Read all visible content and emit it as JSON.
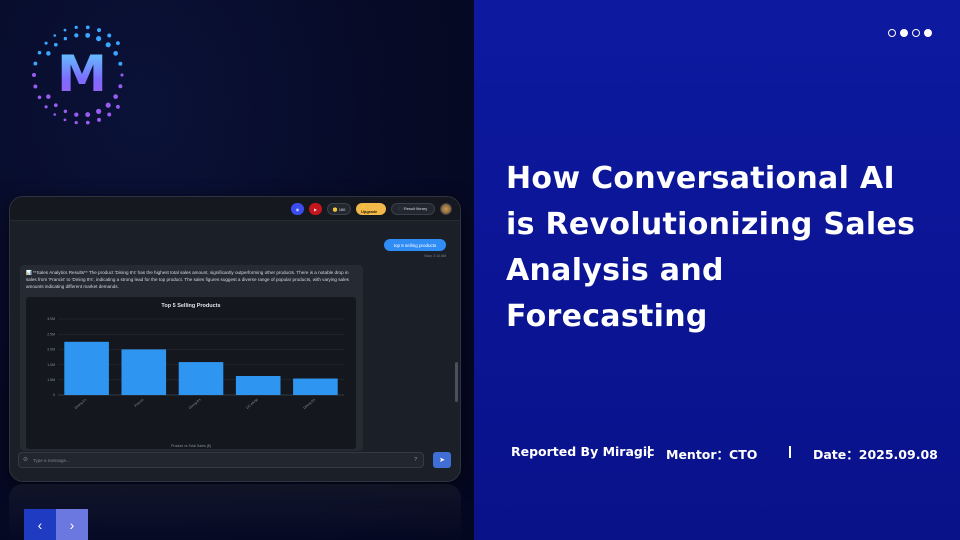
{
  "logo": {
    "letter": "M"
  },
  "app": {
    "topbar": {
      "discord_icon": "discord-icon",
      "youtube_icon": "youtube-icon",
      "credits": "🪙 180",
      "upgrade": "⚡ Upgrade",
      "library": "🗀 Result library"
    },
    "user_message": "top 5 selling products",
    "user_time": "Now, 2:14 AM",
    "bot_text": "📊 **Sales Analytics Results** The product 'Dining 6's' has the highest total sales amount, significantly outperforming other products. There is a notable drop in sales from 'Francis' to 'Dining 8's', indicating a strong lead for the top product. The sales figures suggest a diverse range of popular products, with varying sales amounts indicating different market demands.",
    "input_placeholder": "Type a message...",
    "input_help": "?",
    "send_icon": "➤",
    "chart_data": {
      "type": "bar",
      "title": "Top 5 Selling Products",
      "xlabel": "Product vs Total Sales ($)",
      "ylabel": "",
      "categories": [
        "Dining 6's",
        "Francis",
        "Dining 8's",
        "DC #8-06",
        "Dining 8's"
      ],
      "values": [
        2.1,
        1.8,
        1.3,
        0.75,
        0.65
      ],
      "yticks": [
        "0",
        "1.5M",
        "1.0M",
        "2.0M",
        "2.5M",
        "3.0M"
      ],
      "ylim": [
        0,
        3.0
      ],
      "bar_color": "#2e95f0",
      "grid": true
    }
  },
  "nav": {
    "prev": "‹",
    "next": "›"
  },
  "slide": {
    "title": "How Conversational AI is Revolutionizing Sales Analysis and Forecasting",
    "reporter": "Reported By Miragic",
    "mentor": "Mentor：CTO",
    "date": "Date：2025.09.08"
  },
  "colors": {
    "panel_blue": "#0d1aa0",
    "dark_bg": "#060a26",
    "accent": "#2e95f0"
  }
}
